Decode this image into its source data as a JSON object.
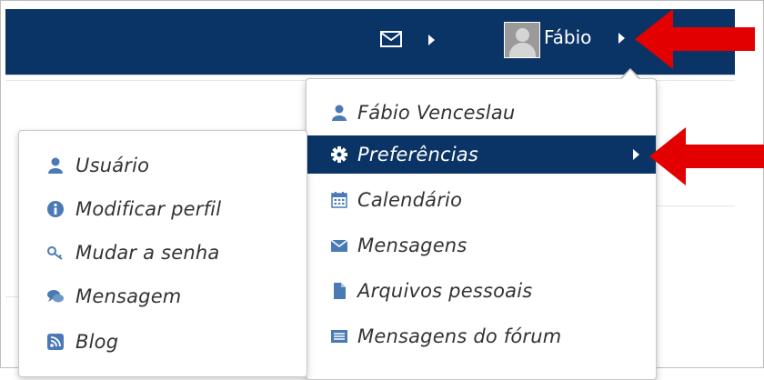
{
  "header": {
    "user_name": "Fábio",
    "icons": {
      "messages": "envelope-icon",
      "avatar": "user-avatar"
    }
  },
  "user_menu": {
    "items": [
      {
        "label": "Fábio Venceslau",
        "icon": "user-icon"
      },
      {
        "label": "Preferências",
        "icon": "gear-icon",
        "active": true,
        "has_submenu": true
      },
      {
        "label": "Calendário",
        "icon": "calendar-icon"
      },
      {
        "label": "Mensagens",
        "icon": "envelope-icon"
      },
      {
        "label": "Arquivos pessoais",
        "icon": "file-icon"
      },
      {
        "label": "Mensagens do fórum",
        "icon": "list-icon"
      }
    ]
  },
  "preferences_submenu": {
    "items": [
      {
        "label": "Usuário",
        "icon": "user-icon"
      },
      {
        "label": "Modificar perfil",
        "icon": "info-icon"
      },
      {
        "label": "Mudar a senha",
        "icon": "key-icon"
      },
      {
        "label": "Mensagem",
        "icon": "chat-icon"
      },
      {
        "label": "Blog",
        "icon": "rss-icon"
      }
    ]
  },
  "colors": {
    "navbar": "#0b3466",
    "active_item": "#0b3466",
    "icon_blue": "#4a7ab5",
    "arrow_red": "#e30000"
  }
}
